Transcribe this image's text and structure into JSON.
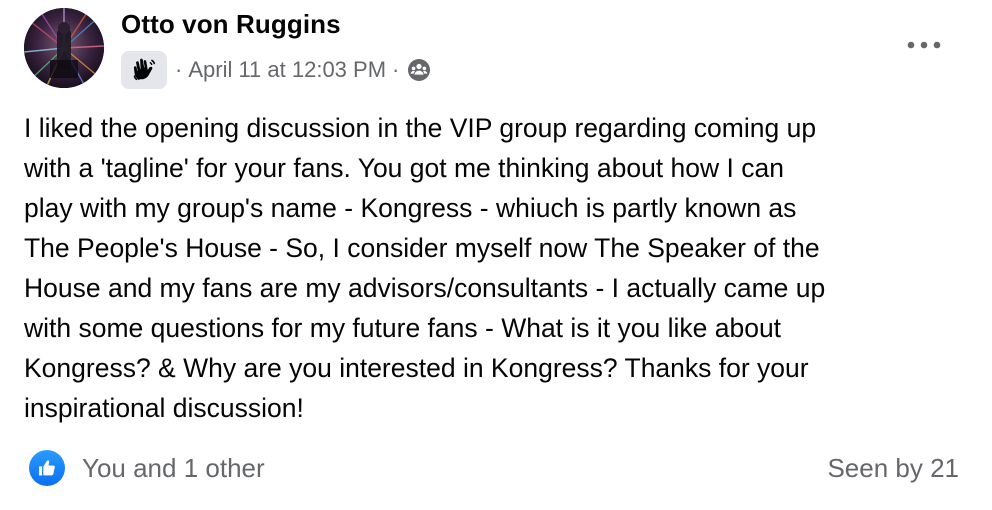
{
  "post": {
    "author": "Otto von Ruggins",
    "badge_icon": "wave-hand-icon",
    "separator": "·",
    "timestamp": "April 11 at 12:03 PM",
    "audience_icon": "group-audience-icon",
    "more_icon": "more-options-icon",
    "body": "I liked the opening discussion in the VIP group regarding coming up\nwith a 'tagline' for your fans. You got me thinking about how I can\nplay with my group's name - Kongress - whiuch is partly known as\nThe People's House - So, I consider myself now The Speaker of the\nHouse and my fans are my advisors/consultants - I actually came up\nwith some questions for my future fans - What is it you like about\nKongress? & Why are you interested in Kongress? Thanks for your\ninspirational discussion!"
  },
  "footer": {
    "reaction_icon": "like-icon",
    "reactors": "You and 1 other",
    "seen": "Seen by 21"
  },
  "colors": {
    "text_primary": "#050505",
    "text_secondary": "#65676b",
    "like_blue": "#0866ff",
    "badge_bg": "#e4e6eb"
  }
}
